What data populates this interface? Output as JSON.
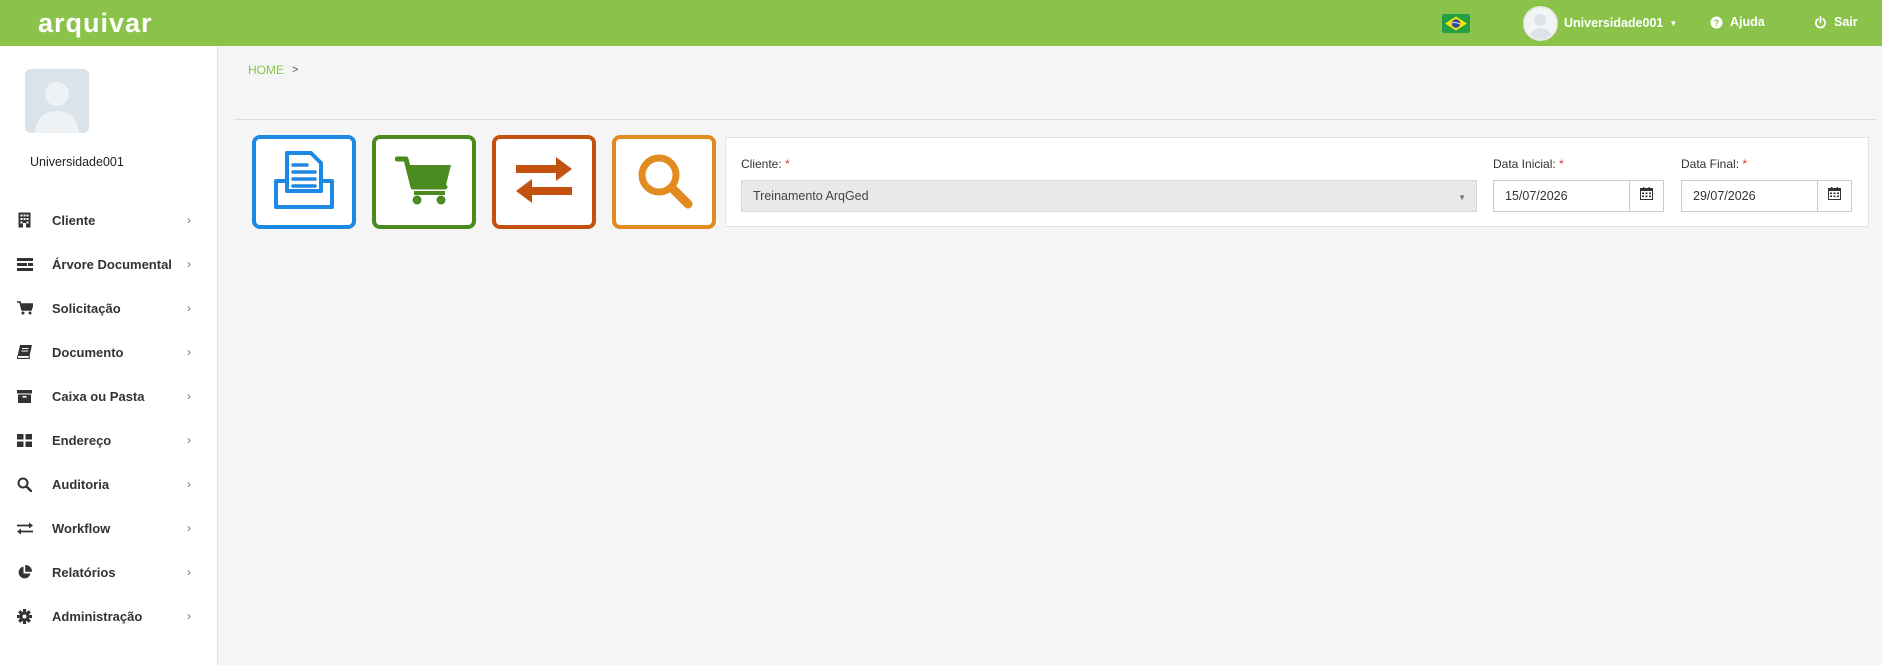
{
  "header": {
    "logo": "arquivar",
    "user_name": "Universidade001",
    "help_label": "Ajuda",
    "logout_label": "Sair",
    "brand_color": "#8bc34a"
  },
  "sidebar": {
    "username": "Universidade001",
    "items": [
      {
        "label": "Cliente",
        "icon": "building-icon"
      },
      {
        "label": "Árvore Documental",
        "icon": "tree-list-icon"
      },
      {
        "label": "Solicitação",
        "icon": "cart-icon"
      },
      {
        "label": "Documento",
        "icon": "book-icon"
      },
      {
        "label": "Caixa ou Pasta",
        "icon": "archive-box-icon"
      },
      {
        "label": "Endereço",
        "icon": "grid-icon"
      },
      {
        "label": "Auditoria",
        "icon": "search-icon"
      },
      {
        "label": "Workflow",
        "icon": "exchange-icon"
      },
      {
        "label": "Relatórios",
        "icon": "pie-chart-icon"
      },
      {
        "label": "Administração",
        "icon": "gear-icon"
      }
    ]
  },
  "breadcrumb": {
    "home": "HOME",
    "separator": ">"
  },
  "shortcuts": [
    {
      "name": "documents",
      "icon": "document-inbox-icon",
      "color": "#1e88e5"
    },
    {
      "name": "cart",
      "icon": "cart-icon",
      "color": "#4b8a1f"
    },
    {
      "name": "transfer",
      "icon": "transfer-arrows-icon",
      "color": "#c2520f"
    },
    {
      "name": "search",
      "icon": "magnifier-icon",
      "color": "#e28b20"
    }
  ],
  "filters": {
    "client_label": "Cliente:",
    "client_value": "Treinamento ArqGed",
    "start_label": "Data Inicial:",
    "start_value": "15/07/2026",
    "end_label": "Data Final:",
    "end_value": "29/07/2026",
    "required_mark": "*"
  }
}
